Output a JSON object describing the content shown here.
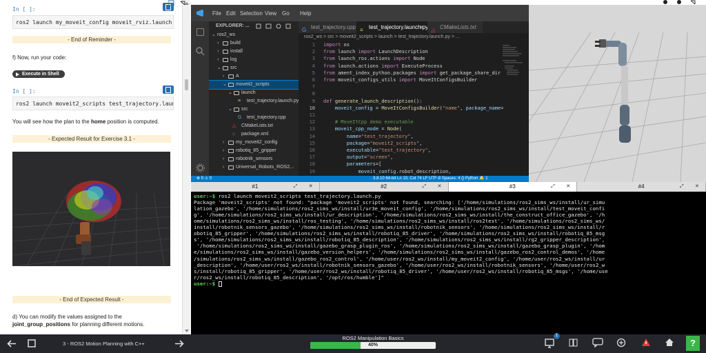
{
  "notebook": {
    "in_label_1": "In [ ]:",
    "code_1": "ros2 launch my_moveit_config moveit_rviz.launch.py",
    "banner_end_reminder": "- End of Reminder -",
    "step_f": "f) Now, run your code:",
    "exec_button": "Execute in Shell #3",
    "in_label_2": "In [ ]:",
    "code_2": "ros2 launch moveit2_scripts test_trajectory.launch.py",
    "para_home_pre": "You will see how the plan to the ",
    "para_home_bold": "home",
    "para_home_post": " position is computed.",
    "banner_expected": "- Expected Result for Exercise 3.1 -",
    "banner_end_expected": "- End of Expected Result -",
    "step_d": "d) You can modify the values assigned to the",
    "step_d_bold": "joint_group_positions",
    "step_d_post": " for planning different motions."
  },
  "vscode": {
    "menu": [
      "File",
      "Edit",
      "Selection",
      "View",
      "Go",
      "Help"
    ],
    "explorer_title": "EXPLORER: ...",
    "tree": [
      {
        "label": "ros2_ws",
        "indent": 0,
        "open": true,
        "folder": false
      },
      {
        "label": "build",
        "indent": 1,
        "open": false,
        "folder": true
      },
      {
        "label": "install",
        "indent": 1,
        "open": false,
        "folder": true
      },
      {
        "label": "log",
        "indent": 1,
        "open": false,
        "folder": true
      },
      {
        "label": "src",
        "indent": 1,
        "open": true,
        "folder": true
      },
      {
        "label": "A",
        "indent": 2,
        "open": false,
        "folder": true
      },
      {
        "label": "moveit2_scripts",
        "indent": 2,
        "open": true,
        "folder": true,
        "selected": true
      },
      {
        "label": "launch",
        "indent": 3,
        "open": true,
        "folder": true
      },
      {
        "label": "test_trajectory.launch.py",
        "indent": 4,
        "file": "py"
      },
      {
        "label": "src",
        "indent": 3,
        "open": true,
        "folder": true
      },
      {
        "label": "test_trajectory.cpp",
        "indent": 4,
        "file": "cpp"
      },
      {
        "label": "CMakeLists.txt",
        "indent": 3,
        "file": "cmake"
      },
      {
        "label": "package.xml",
        "indent": 3,
        "file": "xml"
      },
      {
        "label": "my_moveit2_config",
        "indent": 2,
        "open": false,
        "folder": true
      },
      {
        "label": "robotiq_85_gripper",
        "indent": 2,
        "open": false,
        "folder": true
      },
      {
        "label": "robotnik_sensors",
        "indent": 2,
        "open": false,
        "folder": true
      },
      {
        "label": "Universal_Robots_ROS2...",
        "indent": 2,
        "open": false,
        "folder": true
      }
    ],
    "tabs": [
      {
        "label": "test_trajectory.cpp",
        "active": false
      },
      {
        "label": "test_trajectory.launch.py",
        "active": true
      },
      {
        "label": "CMakeLists.txt",
        "active": false
      }
    ],
    "breadcrumb": "ros2_ws  >  src  >  moveit2_scripts  >  launch  >  test_trajectory.launch.py  >  ...",
    "code_lines": [
      {
        "n": "1",
        "t": "import os"
      },
      {
        "n": "2",
        "t": "from launch import LaunchDescription"
      },
      {
        "n": "3",
        "t": "from launch_ros.actions import Node"
      },
      {
        "n": "4",
        "t": "from launch.actions import ExecuteProcess"
      },
      {
        "n": "5",
        "t": "from ament_index_python.packages import get_package_share_dir"
      },
      {
        "n": "6",
        "t": "from moveit_configs_utils import MoveItConfigsBuilder"
      },
      {
        "n": "7",
        "t": ""
      },
      {
        "n": "8",
        "t": ""
      },
      {
        "n": "9",
        "t": "def generate_launch_description():"
      },
      {
        "n": "10",
        "t": "    moveit_config = MoveItConfigsBuilder(\"name\", package_name="
      },
      {
        "n": "11",
        "t": ""
      },
      {
        "n": "12",
        "t": "    # MoveItCpp demo executable"
      },
      {
        "n": "13",
        "t": "    moveit_cpp_node = Node("
      },
      {
        "n": "14",
        "t": "        name=\"test_trajectory\","
      },
      {
        "n": "15",
        "t": "        package=\"moveit2_scripts\","
      },
      {
        "n": "16",
        "t": "        executable=\"test_trajectory\","
      },
      {
        "n": "17",
        "t": "        output=\"screen\","
      },
      {
        "n": "18",
        "t": "        parameters=["
      },
      {
        "n": "19",
        "t": "            moveit_config.robot_description,"
      }
    ],
    "status_left": "⊗ 0  ⚠ 0",
    "status_right": "3.8.10 64-bit   Ln 10, Col 74   LF   UTF-8   Spaces: 4   {} Python   🔔 1"
  },
  "terminal": {
    "tabs": [
      "#1",
      "#2",
      "#3",
      "#4"
    ],
    "active_tab": 2,
    "prompt": "user:~$",
    "command": " ros2 launch moveit2_scripts test_trajectory.launch.py",
    "output": [
      "Package 'moveit2_scripts' not found: \"package 'moveit2_scripts' not found, searching: ['/home/simulations/ros2_sims_ws/install/ur_simu",
      "lation_gazebo', '/home/simulations/ros2_sims_ws/install/ur3e_moveit_config', '/home/simulations/ros2_sims_ws/install/test_moveit_confi",
      "g', '/home/simulations/ros2_sims_ws/install/ur_description', '/home/simulations/ros2_sims_ws/install/the_construct_office_gazebo', '/h",
      "ome/simulations/ros2_sims_ws/install/ros_testing', '/home/simulations/ros2_sims_ws/install/ros2test', '/home/simulations/ros2_sims_ws/",
      "install/robotnik_sensors_gazebo', '/home/simulations/ros2_sims_ws/install/robotnik_sensors', '/home/simulations/ros2_sims_ws/install/r",
      "obotiq_85_gripper', '/home/simulations/ros2_sims_ws/install/robotiq_85_driver', '/home/simulations/ros2_sims_ws/install/robotiq_85_msg",
      "s', '/home/simulations/ros2_sims_ws/install/robotiq_85_description', '/home/simulations/ros2_sims_ws/install/rg2_gripper_description',",
      " '/home/simulations/ros2_sims_ws/install/gazebo_grasp_plugin_ros', '/home/simulations/ros2_sims_ws/install/gazebo_grasp_plugin', '/hom",
      "e/simulations/ros2_sims_ws/install/gazebo_version_helpers', '/home/simulations/ros2_sims_ws/install/gazebo_ros2_control_demos', '/home",
      "/simulations/ros2_sims_ws/install/gazebo_ros2_control', '/home/user/ros2_ws/install/my_moveit2_config', '/home/user/ros2_ws/install/ur",
      "_description', '/home/user/ros2_ws/install/robotnik_sensors_gazebo', '/home/user/ros2_ws/install/robotnik_sensors', '/home/user/ros2_w",
      "s/install/robotiq_85_gripper', '/home/user/ros2_ws/install/robotiq_85_driver', '/home/user/ros2_ws/install/robotiq_85_msgs', '/home/use",
      "r/ros2_ws/install/robotiq_85_description', '/opt/ros/humble']\""
    ]
  },
  "bottombar": {
    "lesson": "3 - ROS2 Motion Planning with C++",
    "course_title": "ROS2 Manipulation Basics",
    "progress_label": "40%",
    "progress": 0.4,
    "notification_count": "1",
    "help_label": "?"
  },
  "colors": {
    "accent": "#2a6fb3",
    "progress": "#3cb54a",
    "vscode_status": "#007acc",
    "prompt": "#5fd75f"
  }
}
